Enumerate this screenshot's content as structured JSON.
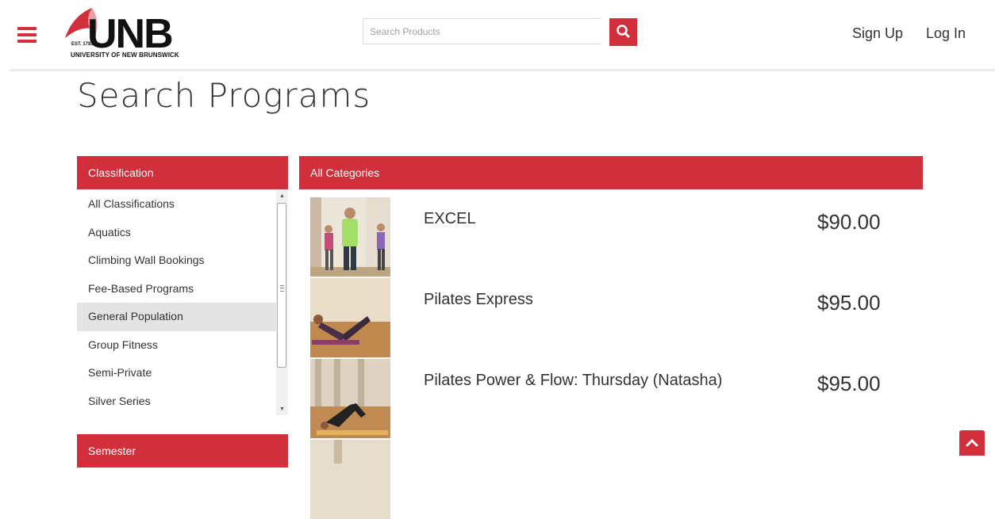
{
  "header": {
    "logo_text": "UNB",
    "logo_est": "EST. 1785",
    "logo_subtitle": "UNIVERSITY OF NEW BRUNSWICK",
    "search_placeholder": "Search Products",
    "signup_label": "Sign Up",
    "login_label": "Log In"
  },
  "page": {
    "title": "Search Programs"
  },
  "sidebar": {
    "classification_header": "Classification",
    "items": [
      {
        "label": "All Classifications",
        "selected": false
      },
      {
        "label": "Aquatics",
        "selected": false
      },
      {
        "label": "Climbing Wall Bookings",
        "selected": false
      },
      {
        "label": "Fee-Based Programs",
        "selected": false
      },
      {
        "label": "General Population",
        "selected": true
      },
      {
        "label": "Group Fitness",
        "selected": false
      },
      {
        "label": "Semi-Private",
        "selected": false
      },
      {
        "label": "Silver Series",
        "selected": false
      }
    ],
    "semester_header": "Semester"
  },
  "products": {
    "category_header": "All Categories",
    "items": [
      {
        "name": "EXCEL",
        "price": "$90.00"
      },
      {
        "name": "Pilates Express",
        "price": "$95.00"
      },
      {
        "name": "Pilates Power & Flow: Thursday (Natasha)",
        "price": "$95.00"
      }
    ]
  },
  "colors": {
    "accent": "#d12f3b",
    "selected_bg": "#e4e4e4"
  },
  "icons": [
    "menu-icon",
    "search-icon",
    "scroll-up-icon",
    "scroll-down-icon",
    "chevron-up-icon"
  ]
}
